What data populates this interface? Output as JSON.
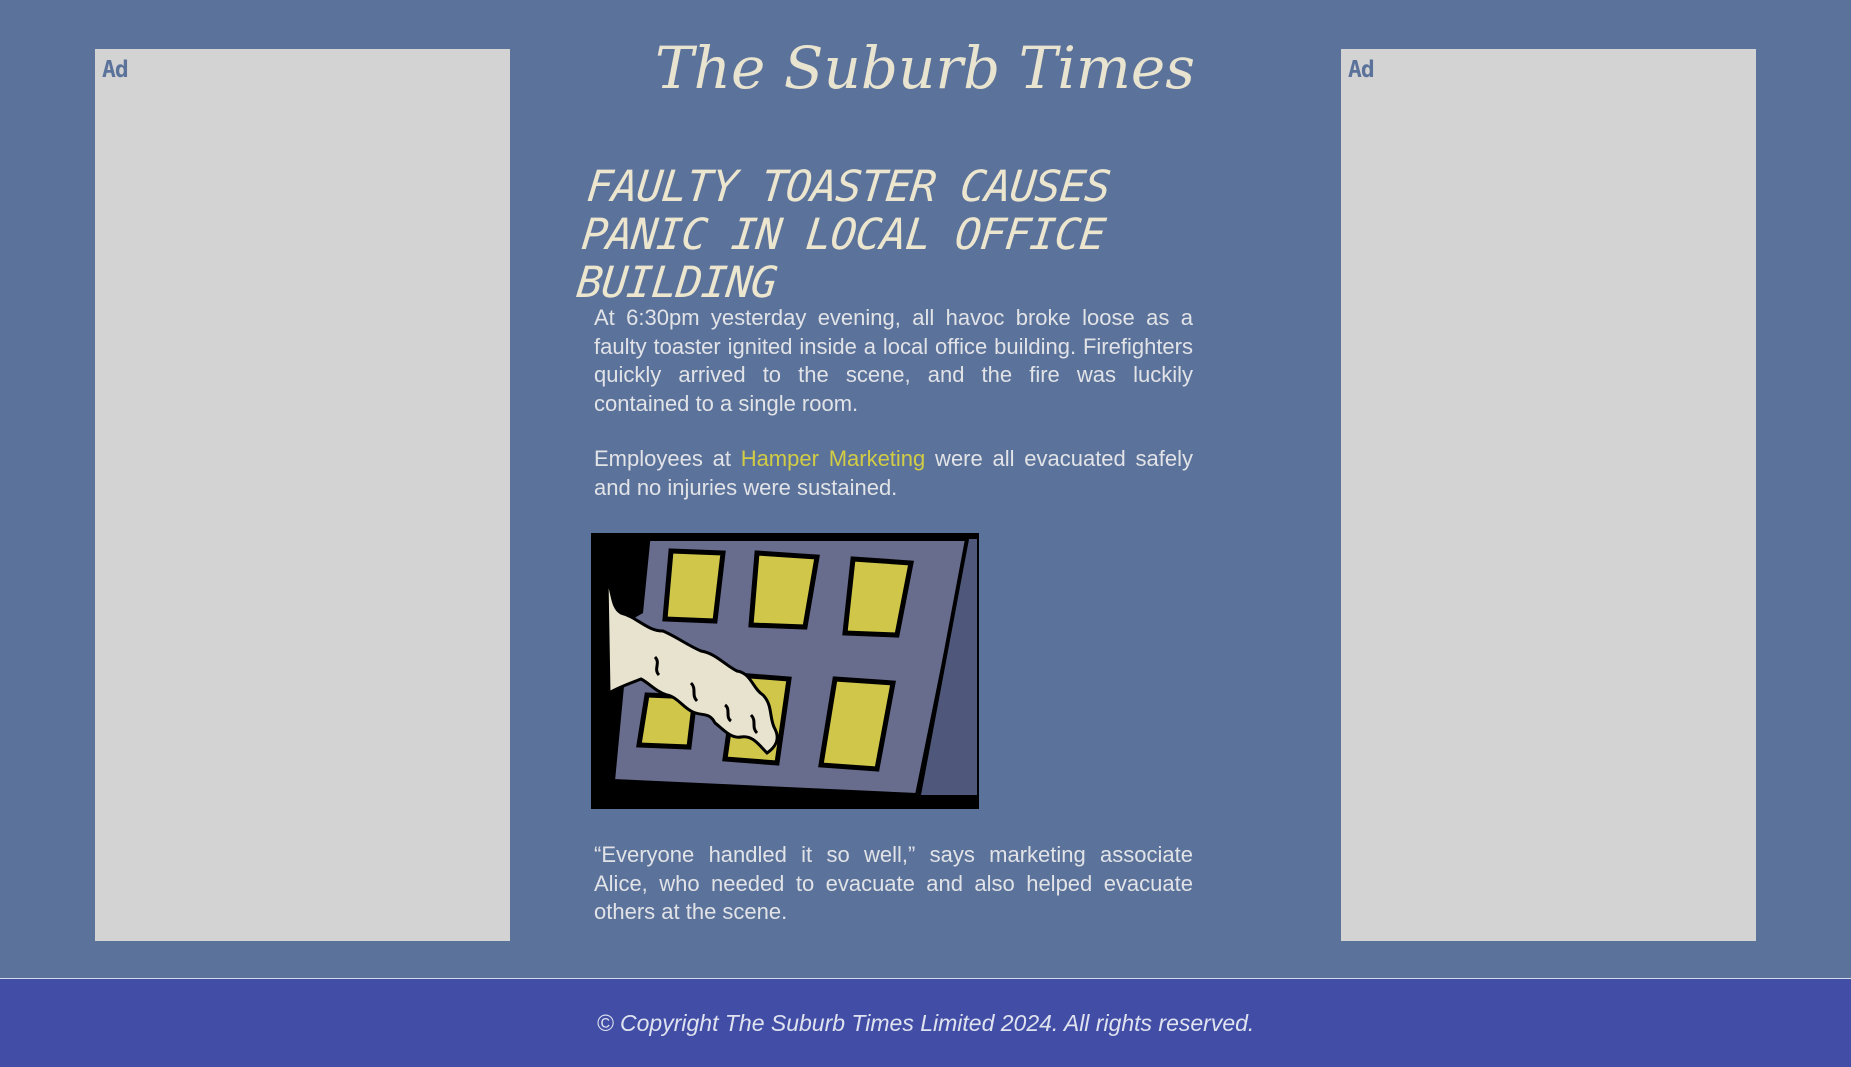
{
  "ads": {
    "left_label": "Ad",
    "right_label": "Ad"
  },
  "masthead": "The Suburb Times",
  "headline": {
    "line1": "FAULTY TOASTER CAUSES",
    "line2": "PANIC IN LOCAL OFFICE BUILDING"
  },
  "article": {
    "p1": "At 6:30pm yesterday evening, all havoc broke loose as a faulty toaster ignited inside a local office building. Firefighters quickly arrived to the scene, and the fire was luckily contained to a single room.",
    "p2_before": "Employees at ",
    "p2_link": "Hamper Marketing",
    "p2_after": " were all evacuated safely and no injuries were sustained.",
    "p3": "“Everyone handled it so well,” says marketing associate Alice, who needed to evacuate and also helped evacuate others at the scene."
  },
  "footer": "© Copyright The Suburb Times Limited 2024. All rights reserved.",
  "colors": {
    "background": "#5b729b",
    "ad_panel": "#d3d3d3",
    "text": "#e1e3e7",
    "link": "#d2cc45",
    "footer": "#424ea6"
  }
}
